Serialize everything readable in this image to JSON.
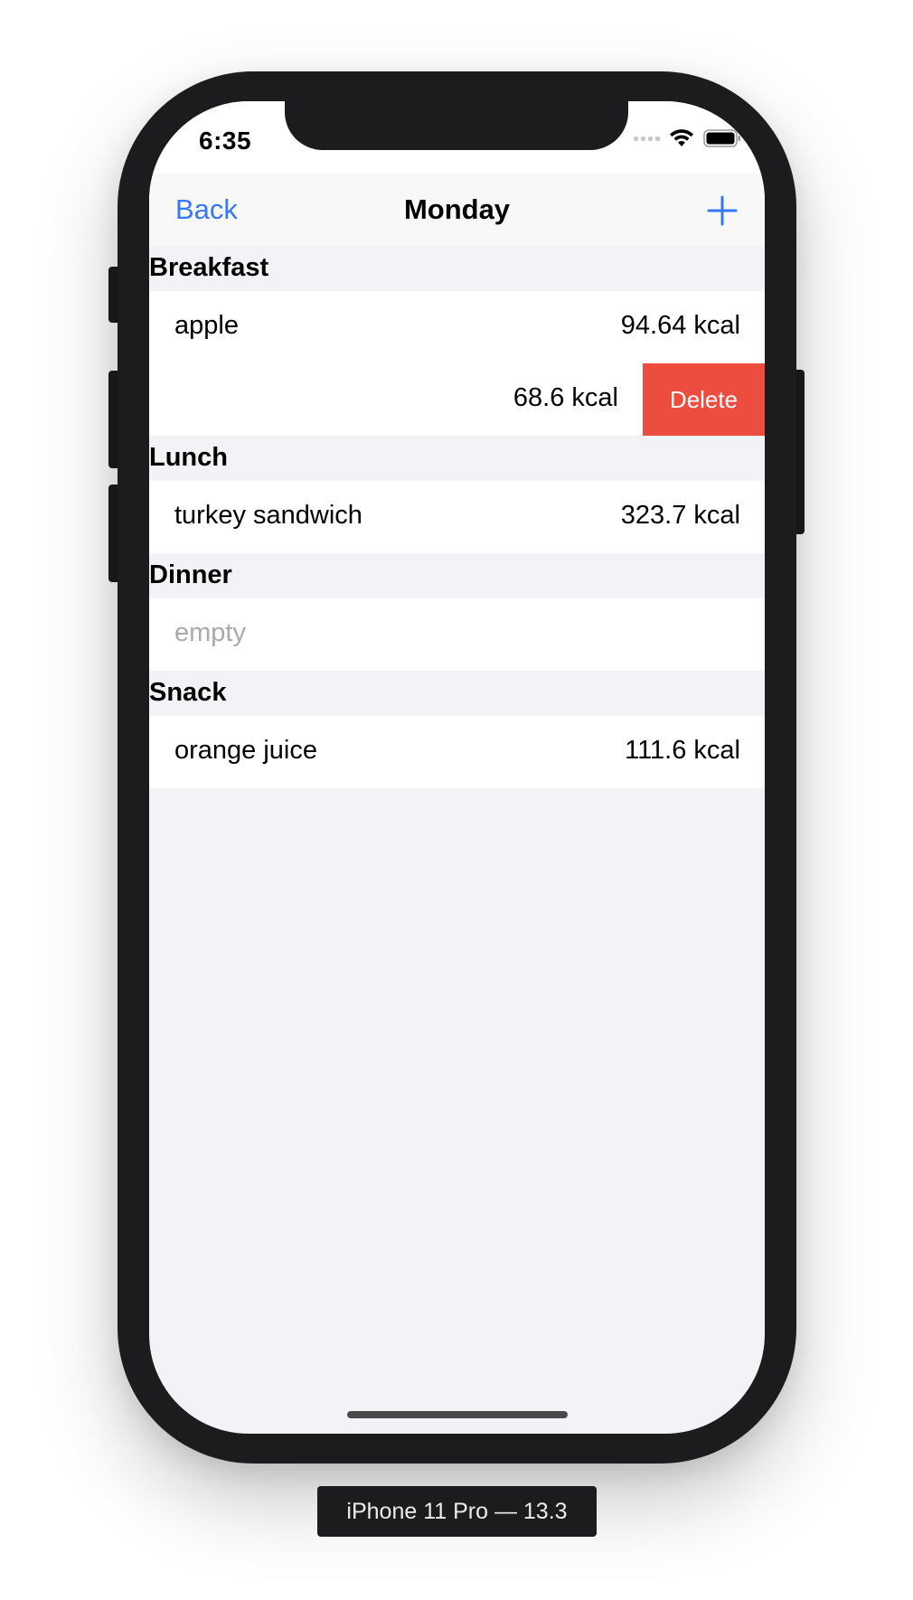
{
  "status_bar": {
    "time": "6:35"
  },
  "nav": {
    "back_label": "Back",
    "title": "Monday",
    "add_icon": "plus-icon"
  },
  "sections": [
    {
      "title": "Breakfast",
      "rows": [
        {
          "name": "apple",
          "kcal": "94.64 kcal"
        },
        {
          "name": "",
          "kcal": "68.6 kcal",
          "swipe_action": "Delete"
        }
      ]
    },
    {
      "title": "Lunch",
      "rows": [
        {
          "name": "turkey sandwich",
          "kcal": "323.7 kcal"
        }
      ]
    },
    {
      "title": "Dinner",
      "rows": [
        {
          "placeholder": "empty"
        }
      ]
    },
    {
      "title": "Snack",
      "rows": [
        {
          "name": "orange juice",
          "kcal": "111.6 kcal"
        }
      ]
    }
  ],
  "device_label": "iPhone 11 Pro — 13.3",
  "colors": {
    "accent": "#3478f6",
    "delete": "#ec4d3f",
    "background": "#f2f2f7",
    "placeholder": "#a9a9ae"
  }
}
